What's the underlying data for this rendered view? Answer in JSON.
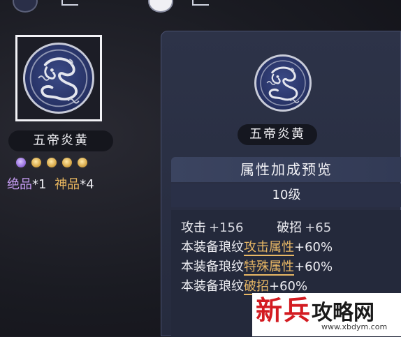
{
  "colors": {
    "background": "#1a1b22",
    "panel": "#2d3348",
    "highlight": "#e9b865",
    "grade_1": "#c59cf2",
    "grade_2": "#e5b45e",
    "watermark_red": "#d31b21"
  },
  "item": {
    "name": "五帝炎黄",
    "emblem_icon": "dragon-emblem-icon",
    "stars": [
      "purple",
      "gold",
      "gold",
      "gold",
      "gold"
    ],
    "grade_1_label": "绝品",
    "grade_1_count": "*1",
    "grade_2_label": "神品",
    "grade_2_count": "*4"
  },
  "panel": {
    "name": "五帝炎黄",
    "section_title": "属性加成预览",
    "level": "10级",
    "stats": [
      {
        "label": "攻击",
        "value": "+156"
      },
      {
        "label": "破招",
        "value": "+65"
      }
    ],
    "bonuses": [
      {
        "prefix": "本装备琅纹",
        "attr": "攻击属性",
        "value": "+60%"
      },
      {
        "prefix": "本装备琅纹",
        "attr": "特殊属性",
        "value": "+60%"
      },
      {
        "prefix": "本装备琅纹",
        "attr": "破招",
        "value": "+60%"
      }
    ]
  },
  "watermark": {
    "brand_red": "新兵",
    "brand_dark": "攻略网",
    "url": "www.xbdym.com"
  }
}
